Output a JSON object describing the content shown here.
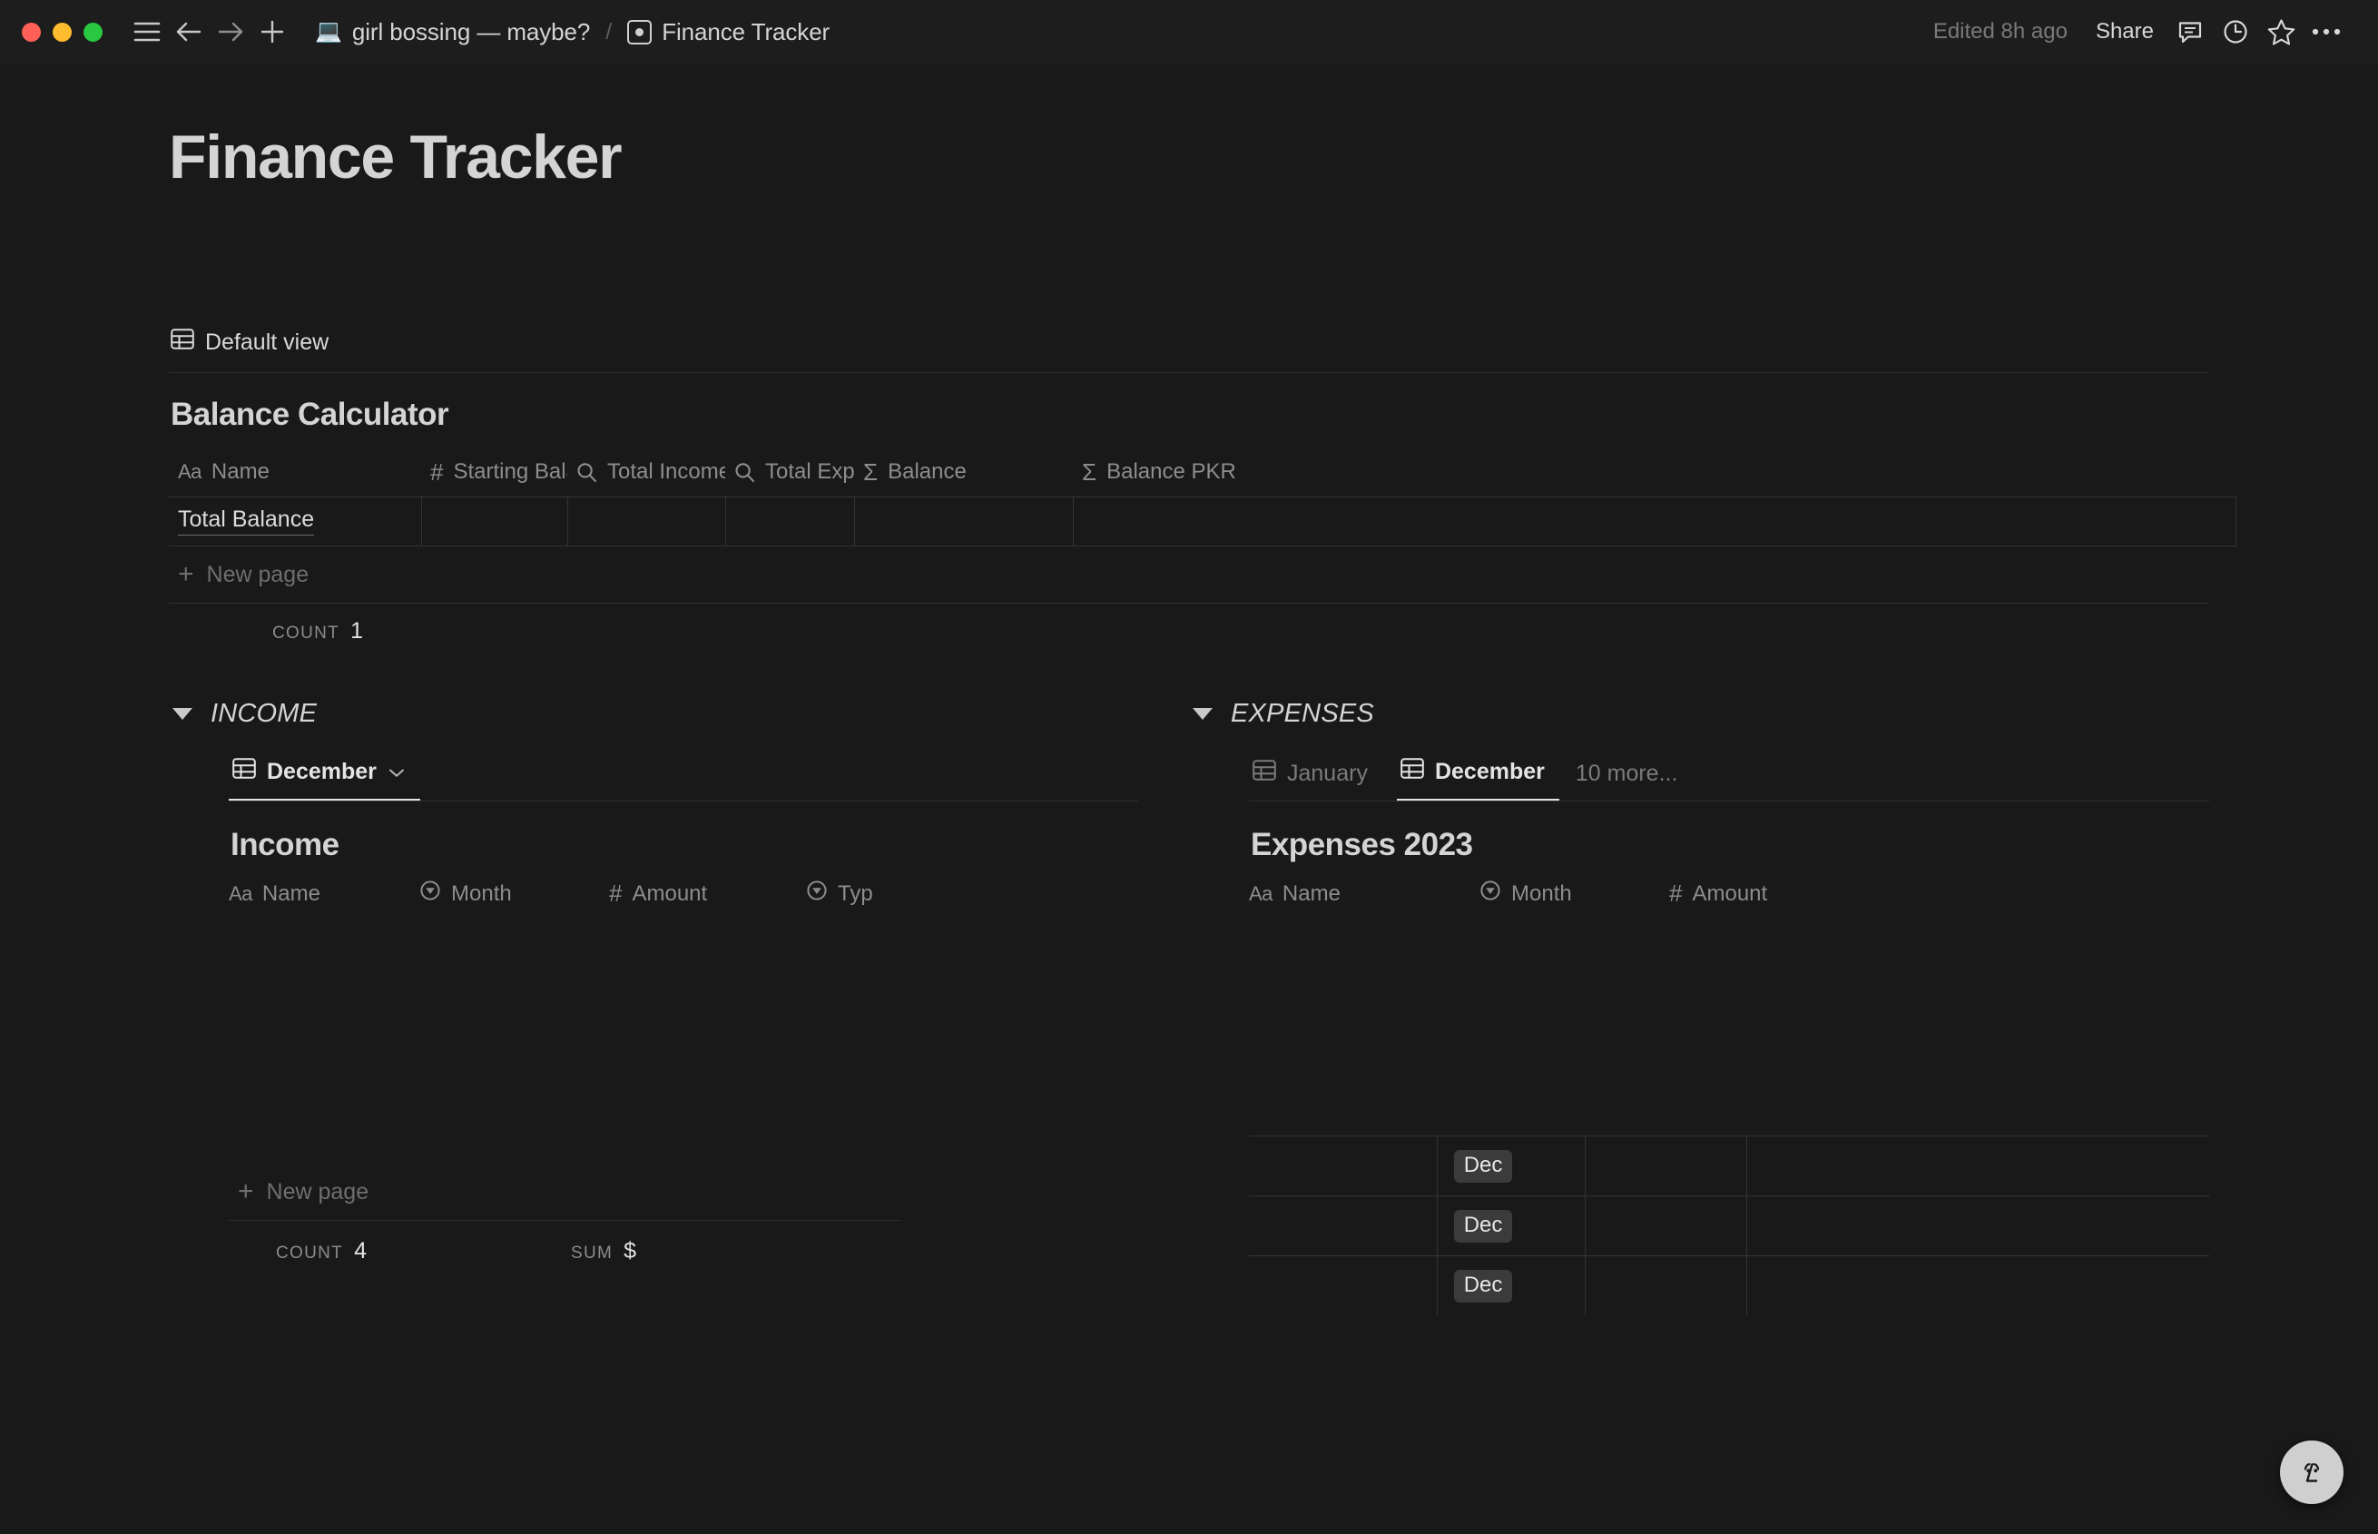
{
  "titlebar": {
    "window_controls": [
      "close",
      "minimize",
      "maximize"
    ],
    "sidebar_toggle": "sidebar-toggle",
    "back": "back",
    "forward": "forward",
    "new": "new",
    "breadcrumb": [
      {
        "icon": "laptop-emoji",
        "glyph": "💻",
        "label": "girl bossing — maybe?"
      },
      {
        "icon": "page-icon",
        "label": "Finance Tracker"
      }
    ],
    "separator": "/",
    "edited": "Edited 8h ago",
    "share_label": "Share",
    "actions": [
      "comment-icon",
      "history-icon",
      "favorite-icon",
      "more-icon"
    ]
  },
  "page": {
    "title": "Finance Tracker"
  },
  "balance_db": {
    "view_label": "Default view",
    "db_title": "Balance Calculator",
    "columns": [
      {
        "label": "Name",
        "icon": "title-icon",
        "glyph": "Aa"
      },
      {
        "label": "Starting Balance",
        "icon": "number-icon",
        "glyph": "#"
      },
      {
        "label": "Total Income",
        "icon": "rollup-icon",
        "glyph": "⌕"
      },
      {
        "label": "Total Expenses",
        "icon": "rollup-icon",
        "glyph": "⌕"
      },
      {
        "label": "Balance",
        "icon": "formula-icon",
        "glyph": "Σ"
      },
      {
        "label": "Balance PKR",
        "icon": "formula-icon",
        "glyph": "Σ"
      }
    ],
    "rows": [
      {
        "name": "Total Balance",
        "starting_balance": "",
        "total_income": "",
        "total_expenses": "",
        "balance": "",
        "balance_pkr": ""
      }
    ],
    "new_page_label": "New page",
    "agg_label": "Count",
    "agg_value": "1"
  },
  "income": {
    "toggle_label": "INCOME",
    "tabs": [
      {
        "label": "December",
        "icon": "table-icon",
        "active": true,
        "has_chevron": true
      }
    ],
    "db_title": "Income",
    "columns": [
      {
        "label": "Name",
        "icon": "title-icon",
        "glyph": "Aa"
      },
      {
        "label": "Month",
        "icon": "select-icon"
      },
      {
        "label": "Amount",
        "icon": "number-icon",
        "glyph": "#"
      },
      {
        "label": "Typ",
        "icon": "select-icon"
      }
    ],
    "new_page_label": "New page",
    "agg_count_label": "Count",
    "agg_count_value": "4",
    "agg_sum_label": "Sum",
    "agg_sum_value": "$"
  },
  "expenses": {
    "toggle_label": "EXPENSES",
    "tabs": [
      {
        "label": "January",
        "icon": "table-icon",
        "active": false
      },
      {
        "label": "December",
        "icon": "table-icon",
        "active": true
      },
      {
        "label": "10 more...",
        "icon": "",
        "active": false
      }
    ],
    "db_title": "Expenses 2023",
    "columns": [
      {
        "label": "Name",
        "icon": "title-icon",
        "glyph": "Aa"
      },
      {
        "label": "Month",
        "icon": "select-icon"
      },
      {
        "label": "Amount",
        "icon": "number-icon",
        "glyph": "#"
      }
    ],
    "rows": [
      {
        "name": "",
        "month": "Dec",
        "amount": ""
      },
      {
        "name": "",
        "month": "Dec",
        "amount": ""
      },
      {
        "name": "",
        "month": "Dec",
        "amount": ""
      }
    ]
  },
  "ai_button": {
    "name": "notion-ai-face"
  },
  "colors": {
    "background": "#191919",
    "titlebar": "#1d1d1d",
    "border": "#333333",
    "text_primary": "#d4d4d4",
    "text_muted": "#8d8d8d",
    "pill_bg": "#3b3b3b",
    "accent_red": "#ff5f57",
    "accent_yellow": "#febc2e",
    "accent_green": "#28c840"
  }
}
